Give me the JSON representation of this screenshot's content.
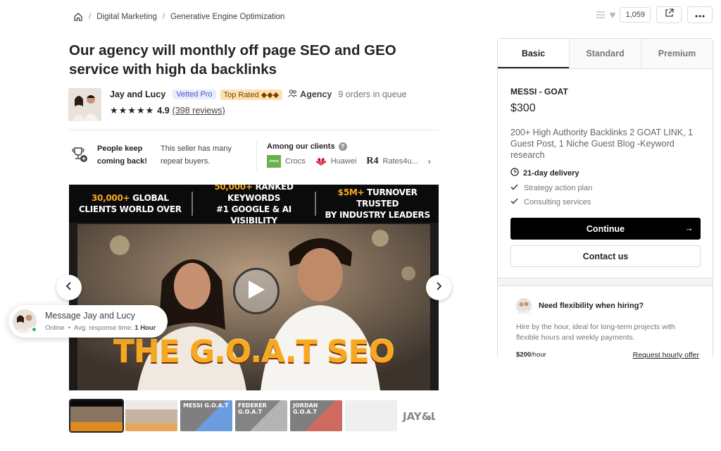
{
  "breadcrumb": {
    "items": [
      "Digital Marketing",
      "Generative Engine Optimization"
    ]
  },
  "top_actions": {
    "like_count": "1,059"
  },
  "gig": {
    "title": "Our agency will monthly off page SEO and GEO service with high da backlinks"
  },
  "seller": {
    "name": "Jay and Lucy",
    "vetted_badge": "Vetted Pro",
    "top_rated_badge": "Top Rated ◆◆◆",
    "agency_label": "Agency",
    "queue": "9 orders in queue",
    "stars": "★★★★★",
    "rating": "4.9",
    "reviews": "(398 reviews)"
  },
  "highlights": {
    "keep_title": "People keep coming back!",
    "keep_desc": "This seller has many repeat buyers.",
    "clients_label": "Among our clients",
    "clients": [
      "Crocs",
      "Huawei",
      "Rates4u..."
    ]
  },
  "media": {
    "stat1_hl": "30,000+",
    "stat1_a": " GLOBAL",
    "stat1_b": "CLIENTS WORLD OVER",
    "stat2_hl": "50,000+",
    "stat2_a": " RANKED KEYWORDS",
    "stat2_b": "#1 GOOGLE & AI VISIBILITY",
    "stat3_hl": "$5M+",
    "stat3_a": " TURNOVER TRUSTED",
    "stat3_b": "BY INDUSTRY LEADERS",
    "headline": "THE G.O.A.T SEO"
  },
  "message": {
    "title": "Message Jay and Lucy",
    "status": "Online",
    "response_label": "Avg. response time:",
    "response_value": "1 Hour"
  },
  "thumbnails": [
    {
      "label": ""
    },
    {
      "label": ""
    },
    {
      "label": "MESSI G.O.A.T"
    },
    {
      "label": "FEDERER G.O.A.T"
    },
    {
      "label": "JORDAN G.O.A.T"
    },
    {
      "label": ""
    },
    {
      "label": "JAY&LU"
    }
  ],
  "package": {
    "tabs": [
      "Basic",
      "Standard",
      "Premium"
    ],
    "name": "MESSI - GOAT",
    "price": "$300",
    "description": "200+ High Authority Backlinks 2 GOAT LINK, 1 Guest Post, 1 Niche Guest Blog -Keyword research",
    "delivery": "21-day delivery",
    "features": [
      "Strategy action plan",
      "Consulting services"
    ],
    "continue_label": "Continue",
    "contact_label": "Contact us"
  },
  "hourly": {
    "title": "Need flexibility when hiring?",
    "description": "Hire by the hour, ideal for long-term projects with flexible hours and weekly payments.",
    "rate": "$200",
    "rate_unit": "/hour",
    "request_label": "Request hourly offer"
  }
}
